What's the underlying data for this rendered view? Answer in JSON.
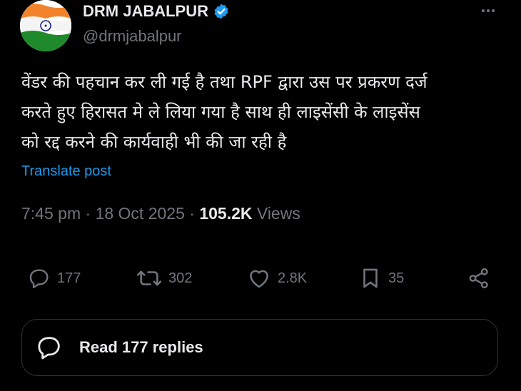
{
  "author": {
    "display_name": "DRM JABALPUR",
    "handle": "@drmjabalpur",
    "verified": true,
    "verified_color": "#1d9bf0",
    "avatar": "india-flag"
  },
  "post": {
    "text_lines": [
      "वेंडर की पहचान कर ली गई है तथा RPF द्वारा उस पर प्रकरण दर्ज",
      "करते हुए हिरासत मे ले लिया गया है साथ ही लाइसेंसी के लाइसेंस",
      "को रद्द करने की कार्यवाही भी की जा रही है"
    ],
    "translate_label": "Translate post",
    "time": "7:45 pm",
    "date": "18 Oct 2025",
    "separator": "·",
    "views_count": "105.2K",
    "views_label": "Views"
  },
  "actions": {
    "replies": "177",
    "reposts": "302",
    "likes": "2.8K",
    "bookmarks": "35"
  },
  "read_replies": {
    "label": "Read 177 replies"
  },
  "colors": {
    "background": "#000000",
    "text": "#e7e9ea",
    "muted": "#71767b",
    "link": "#1d9bf0",
    "border": "#2f3336"
  }
}
